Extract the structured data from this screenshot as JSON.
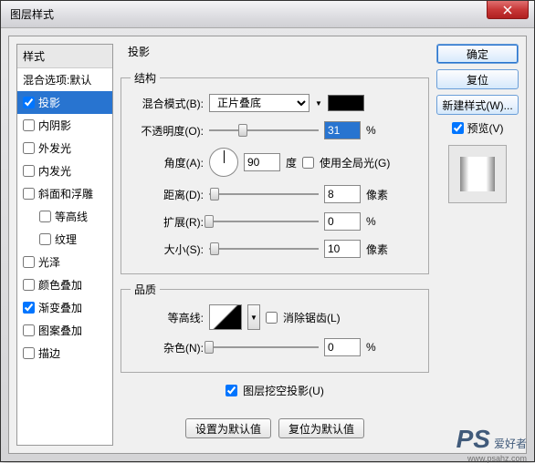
{
  "window": {
    "title": "图层样式"
  },
  "sidebar": {
    "header": "样式",
    "blendOpts": "混合选项:默认",
    "items": [
      {
        "label": "投影",
        "checked": true,
        "selected": true
      },
      {
        "label": "内阴影",
        "checked": false
      },
      {
        "label": "外发光",
        "checked": false
      },
      {
        "label": "内发光",
        "checked": false
      },
      {
        "label": "斜面和浮雕",
        "checked": false
      },
      {
        "label": "等高线",
        "checked": false,
        "indent": true
      },
      {
        "label": "纹理",
        "checked": false,
        "indent": true
      },
      {
        "label": "光泽",
        "checked": false
      },
      {
        "label": "颜色叠加",
        "checked": false
      },
      {
        "label": "渐变叠加",
        "checked": true
      },
      {
        "label": "图案叠加",
        "checked": false
      },
      {
        "label": "描边",
        "checked": false
      }
    ]
  },
  "main": {
    "title": "投影",
    "structure": {
      "legend": "结构",
      "blendModeLabel": "混合模式(B):",
      "blendModeValue": "正片叠底",
      "opacityLabel": "不透明度(O):",
      "opacityValue": "31",
      "opacityPct": 31,
      "angleLabel": "角度(A):",
      "angleValue": "90",
      "angleUnit": "度",
      "globalLight": "使用全局光(G)",
      "globalLightChecked": false,
      "distanceLabel": "距离(D):",
      "distanceValue": "8",
      "distancePct": 5,
      "spreadLabel": "扩展(R):",
      "spreadValue": "0",
      "spreadPct": 0,
      "sizeLabel": "大小(S):",
      "sizeValue": "10",
      "sizePct": 5,
      "pixelUnit": "像素",
      "percentUnit": "%"
    },
    "quality": {
      "legend": "品质",
      "contourLabel": "等高线:",
      "antiAlias": "消除锯齿(L)",
      "antiAliasChecked": false,
      "noiseLabel": "杂色(N):",
      "noiseValue": "0",
      "noisePct": 0
    },
    "knockout": {
      "label": "图层挖空投影(U)",
      "checked": true
    },
    "buttons": {
      "setDefault": "设置为默认值",
      "resetDefault": "复位为默认值"
    }
  },
  "right": {
    "ok": "确定",
    "cancel": "复位",
    "newStyle": "新建样式(W)...",
    "preview": "预览(V)",
    "previewChecked": true
  },
  "watermark": {
    "ps": "PS",
    "text": "爱好者",
    "url": "www.psahz.com"
  }
}
